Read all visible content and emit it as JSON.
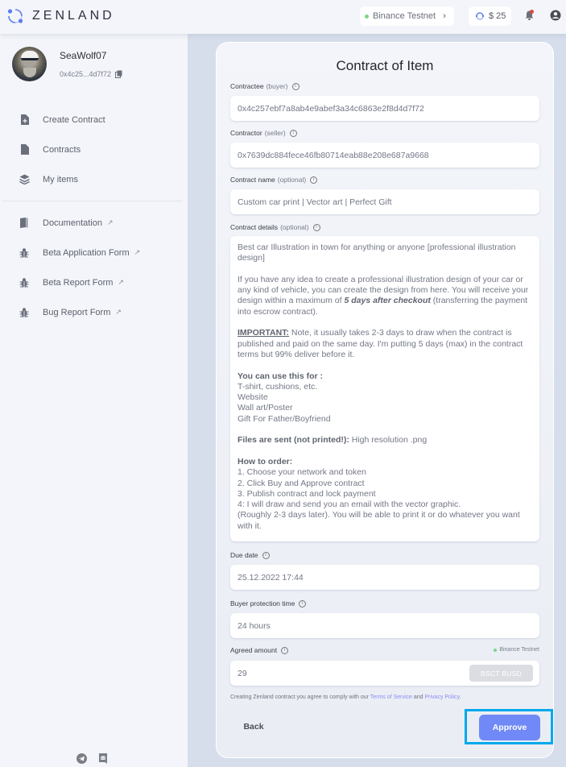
{
  "app": {
    "brand": "ZENLAND"
  },
  "topbar": {
    "network_label": "Binance Testnet",
    "network_status_color": "#7ed389",
    "balance": "$ 25",
    "notification_badge_color": "#e0473e"
  },
  "profile": {
    "username": "SeaWolf07",
    "address_short": "0x4c25...4d7f72"
  },
  "sidebar": {
    "items": [
      {
        "label": "Create Contract",
        "icon": "file-plus-icon",
        "external": false
      },
      {
        "label": "Contracts",
        "icon": "file-icon",
        "external": false
      },
      {
        "label": "My items",
        "icon": "layers-icon",
        "external": false
      }
    ],
    "external_items": [
      {
        "label": "Documentation",
        "icon": "book-icon",
        "external": true
      },
      {
        "label": "Beta Application Form",
        "icon": "bug-icon",
        "external": true
      },
      {
        "label": "Beta Report Form",
        "icon": "bug-icon",
        "external": true
      },
      {
        "label": "Bug Report Form",
        "icon": "bug-icon",
        "external": true
      }
    ],
    "external_marker": "↗",
    "socials": [
      "telegram-icon",
      "discord-icon"
    ]
  },
  "form": {
    "title": "Contract of Item",
    "contractee": {
      "label": "Contractee",
      "hint": "(buyer)",
      "value": "0x4c257ebf7a8ab4e9abef3a34c6863e2f8d4d7f72"
    },
    "contractor": {
      "label": "Contractor",
      "hint": "(seller)",
      "value": "0x7639dc884fece46fb80714eab88e208e687a9668"
    },
    "contract_name": {
      "label": "Contract name",
      "hint": "(optional)",
      "value": "Custom car print | Vector art | Perfect Gift"
    },
    "contract_details": {
      "label": "Contract details",
      "hint": "(optional)",
      "intro": "Best car Illustration in town for anything or anyone [professional illustration design]",
      "para2_before": "If you have any idea to create a professional illustration design of your car or any kind of vehicle, you can create the design from here. You will receive your design within a maximum of ",
      "para2_emph": "5 days after checkout",
      "para2_after": " (transferring the payment into escrow contract).",
      "important_label": "IMPORTANT:",
      "important_text": " Note, it usually takes 2-3 days to draw when the contract is published and paid on the same day. I'm putting 5 days (max) in the contract terms but 99% deliver before it.",
      "use_heading": "You can use this for :",
      "use_items": [
        "T-shirt, cushions, etc.",
        "Website",
        "Wall art/Poster",
        "Gift For Father/Boyfriend"
      ],
      "files_label": "Files are sent (not printed!):",
      "files_text": " High resolution .png",
      "order_heading": "How to order:",
      "order_steps": [
        "1. Choose your network and token",
        "2. Click Buy and Approve contract",
        "3. Publish contract and lock payment",
        "4: I will draw and send you an email with the vector graphic.",
        "(Roughly 2-3 days later). You will be able to print it or do whatever you want with it."
      ]
    },
    "due_date": {
      "label": "Due date",
      "value": "25.12.2022 17:44"
    },
    "buyer_protection": {
      "label": "Buyer protection time",
      "value": "24 hours"
    },
    "agreed_amount": {
      "label": "Agreed amount",
      "value": "29",
      "token": "BSCT BUSD",
      "network": "Binance Testnet"
    },
    "terms": {
      "before": "Creating Zenland contract you agree to comply with our ",
      "tos": "Terms of Service",
      "and": " and ",
      "privacy": "Privacy Policy",
      "after": "."
    },
    "back_label": "Back",
    "approve_label": "Approve",
    "accent_color": "#7089f6",
    "highlight_color": "#00a8ec"
  }
}
